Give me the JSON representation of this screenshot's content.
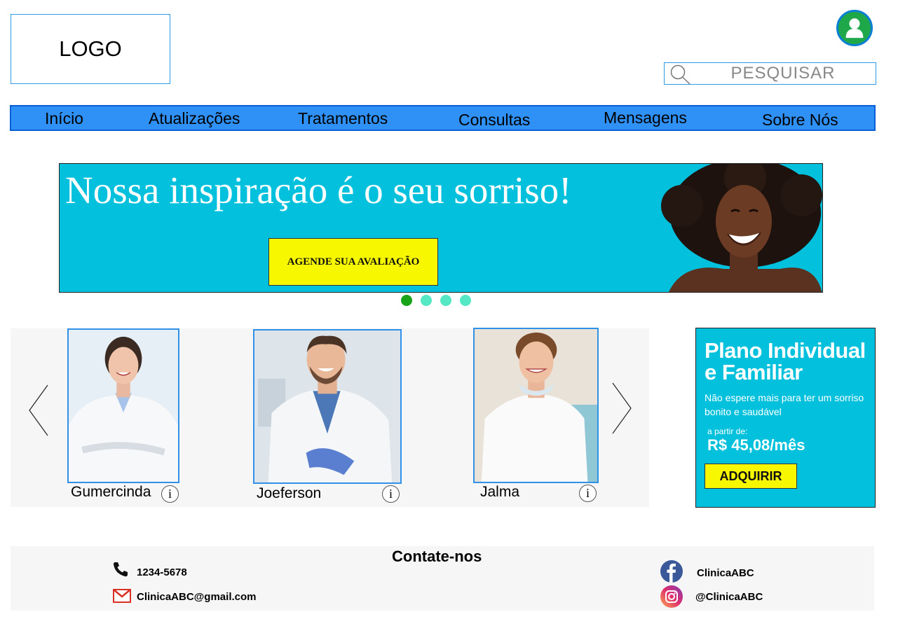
{
  "header": {
    "logo_text": "LOGO",
    "search_placeholder": "PESQUISAR"
  },
  "nav": {
    "items": [
      {
        "label": "Início"
      },
      {
        "label": "Atualizações"
      },
      {
        "label": "Tratamentos"
      },
      {
        "label": "Consultas"
      },
      {
        "label": "Mensagens"
      },
      {
        "label": "Sobre Nós"
      }
    ]
  },
  "banner": {
    "title": "Nossa inspiração é o seu sorriso!",
    "cta_label": "AGENDE SUA AVALIAÇÃO",
    "slides_total": 4,
    "active_slide": 1
  },
  "team": {
    "members": [
      {
        "name": "Gumercinda"
      },
      {
        "name": "Joeferson"
      },
      {
        "name": "Jalma"
      }
    ],
    "info_symbol": "i"
  },
  "plan": {
    "title": "Plano Individual e Familiar",
    "description": "Não espere mais para ter um sorriso bonito e saudável",
    "from_label": "a partir de:",
    "price": "R$ 45,08/mês",
    "button_label": "ADQUIRIR"
  },
  "contact": {
    "title": "Contate-nos",
    "phone": "1234-5678",
    "email": "ClinicaABC@gmail.com",
    "facebook": "ClinicaABC",
    "instagram": "@ClinicaABC"
  },
  "colors": {
    "nav_bg": "#2f90f5",
    "banner_bg": "#03c1dd",
    "cta_bg": "#f7f700",
    "active_dot": "#19a319",
    "inactive_dot": "#55e8c4",
    "avatar_bg": "#1fa84a"
  },
  "icons": [
    "user-icon",
    "search-icon",
    "chevron-left-icon",
    "chevron-right-icon",
    "info-icon",
    "phone-icon",
    "mail-icon",
    "facebook-icon",
    "instagram-icon"
  ]
}
